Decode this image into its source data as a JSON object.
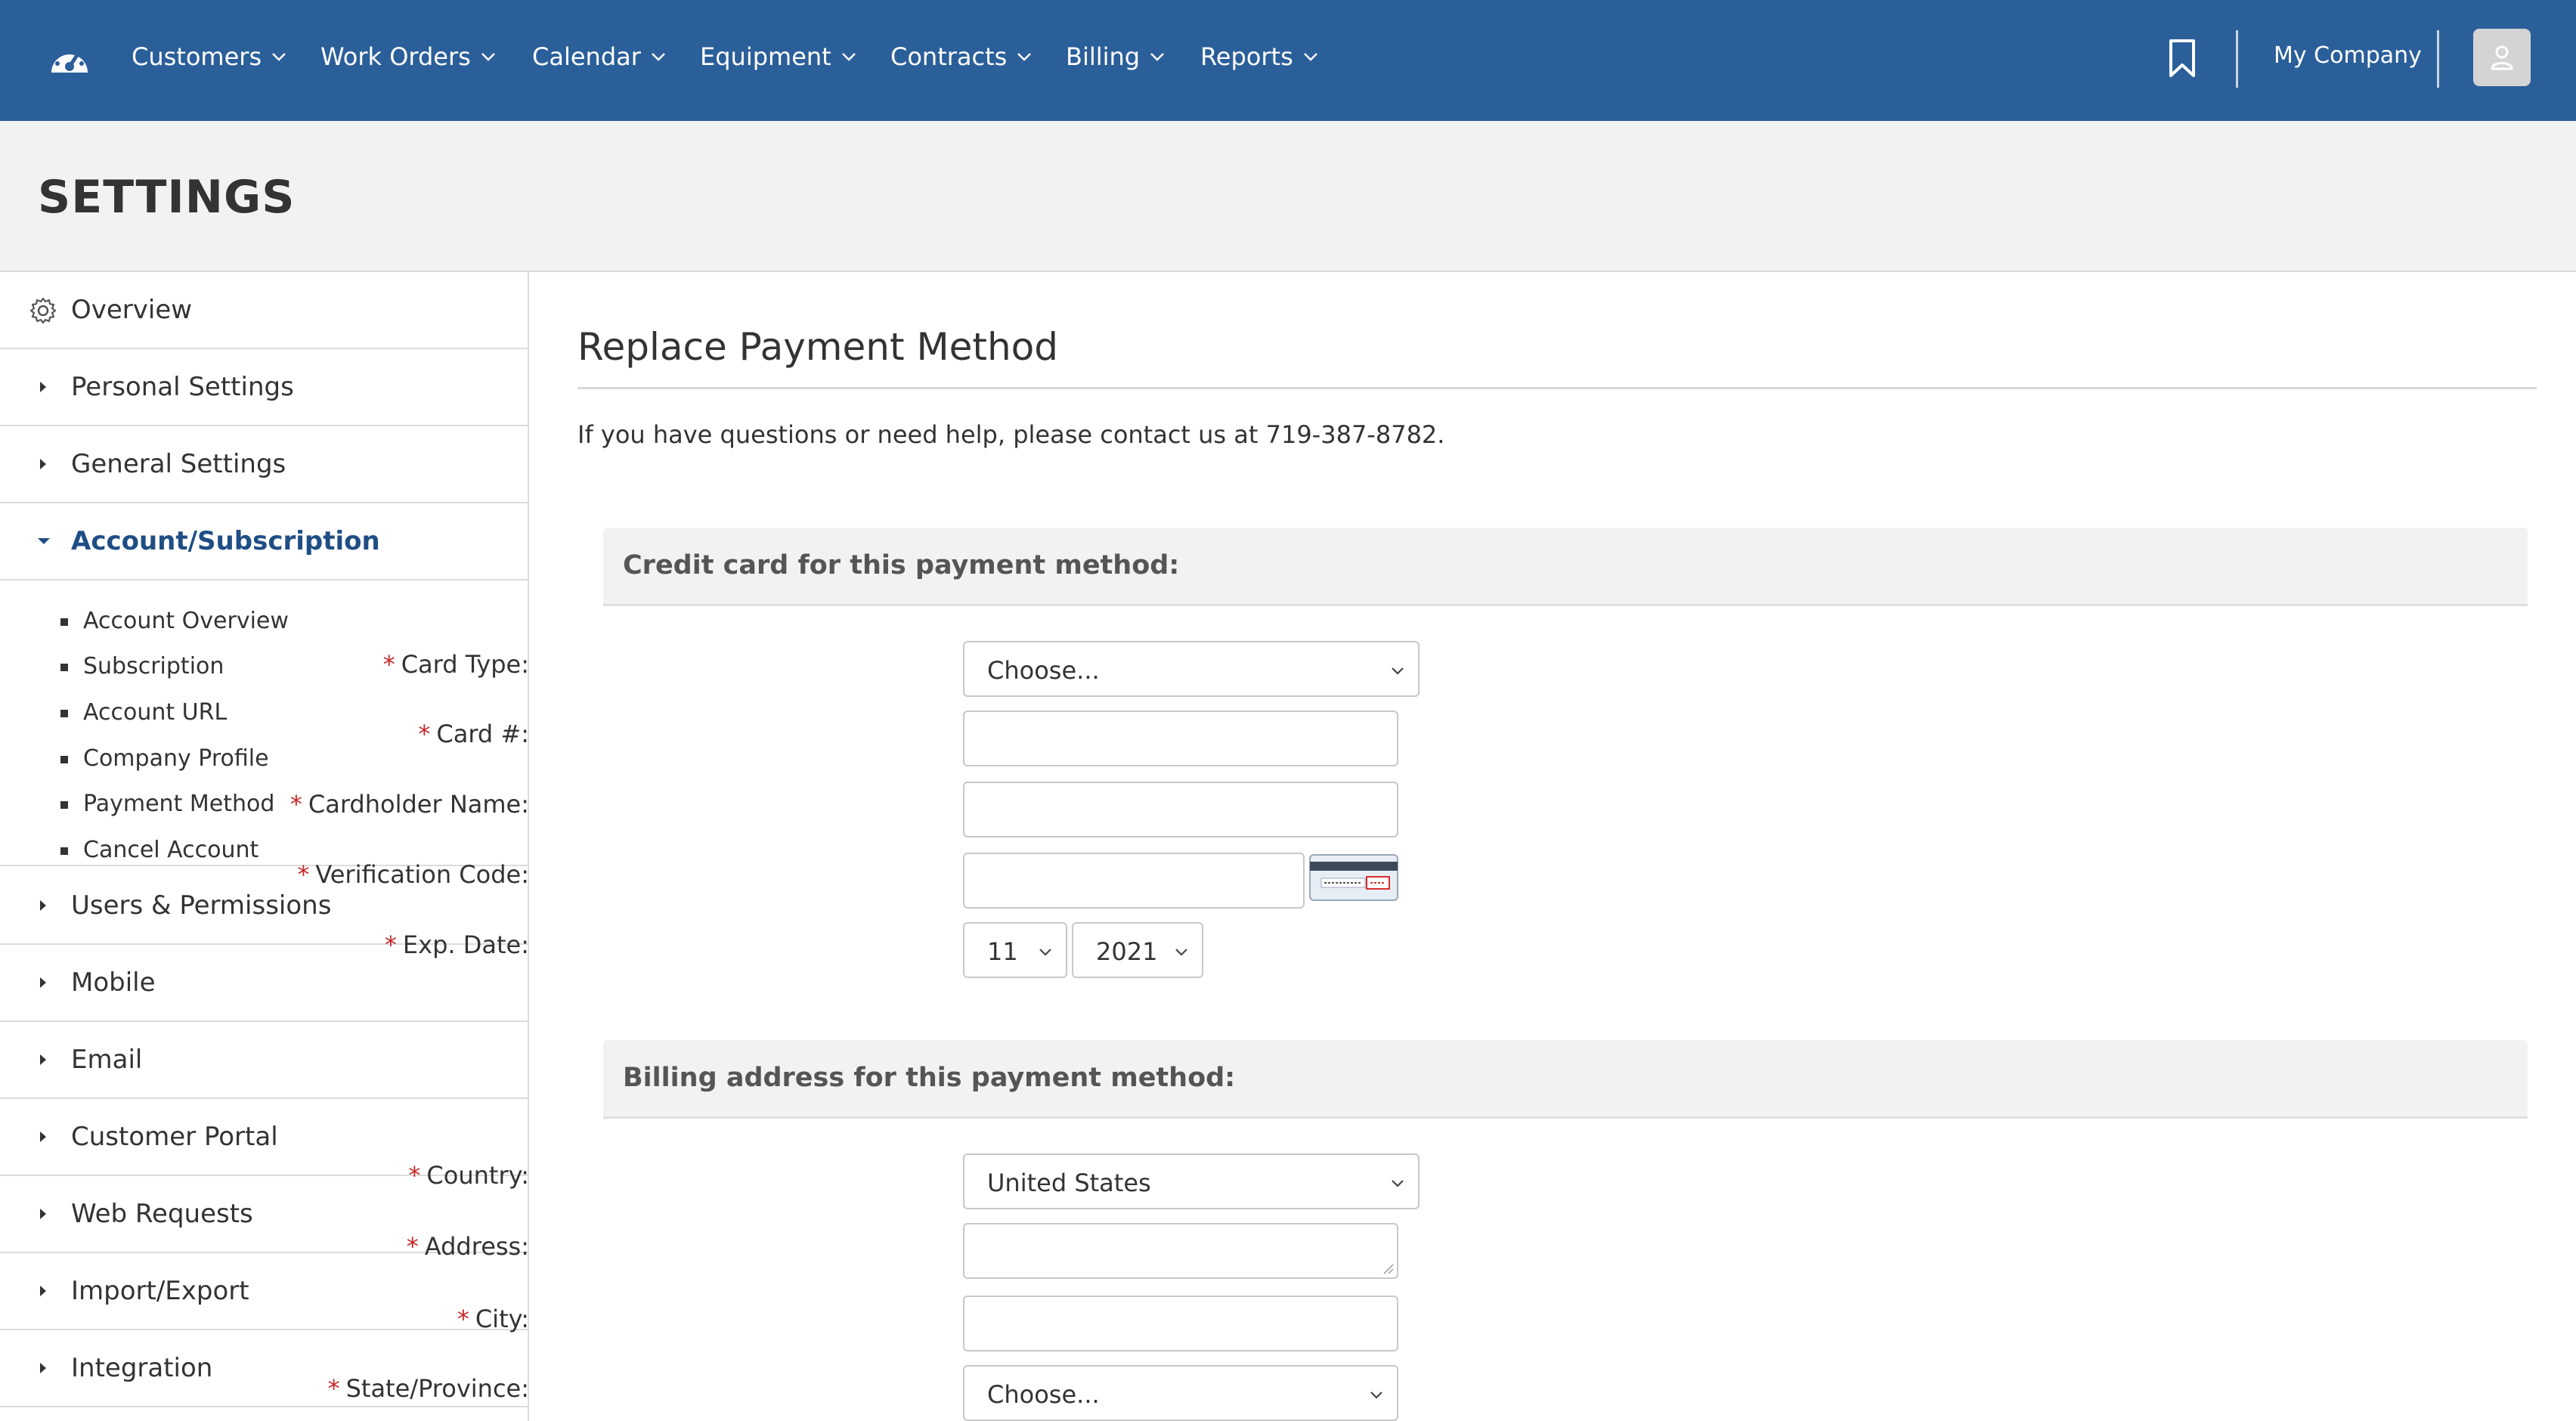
{
  "topnav": {
    "items": [
      {
        "label": "Customers"
      },
      {
        "label": "Work Orders"
      },
      {
        "label": "Calendar"
      },
      {
        "label": "Equipment"
      },
      {
        "label": "Contracts"
      },
      {
        "label": "Billing"
      },
      {
        "label": "Reports"
      }
    ],
    "company": "My Company",
    "icons": {
      "logo": "speedometer-icon",
      "bookmark": "bookmark-icon",
      "avatar": "user-icon"
    },
    "colors": {
      "background": "#2b5f9a",
      "text": "#ffffff"
    }
  },
  "header": {
    "title": "SETTINGS"
  },
  "sidebar": {
    "items": [
      {
        "label": "Overview",
        "icon": "gear-icon"
      },
      {
        "label": "Personal Settings",
        "icon": "caret-right-icon"
      },
      {
        "label": "General Settings",
        "icon": "caret-right-icon"
      },
      {
        "label": "Account/Subscription",
        "icon": "caret-down-icon",
        "active": true
      },
      {
        "label": "Users & Permissions",
        "icon": "caret-right-icon"
      },
      {
        "label": "Mobile",
        "icon": "caret-right-icon"
      },
      {
        "label": "Email",
        "icon": "caret-right-icon"
      },
      {
        "label": "Customer Portal",
        "icon": "caret-right-icon"
      },
      {
        "label": "Web Requests",
        "icon": "caret-right-icon"
      },
      {
        "label": "Import/Export",
        "icon": "caret-right-icon"
      },
      {
        "label": "Integration",
        "icon": "caret-right-icon"
      }
    ],
    "sub_items": [
      {
        "label": "Account Overview"
      },
      {
        "label": "Subscription"
      },
      {
        "label": "Account URL"
      },
      {
        "label": "Company Profile"
      },
      {
        "label": "Payment Method"
      },
      {
        "label": "Cancel Account"
      }
    ],
    "active_color": "#1f4e85"
  },
  "main": {
    "title": "Replace Payment Method",
    "help_text": "If you have questions or need help, please contact us at 719-387-8782.",
    "credit_section": {
      "heading": "Credit card for this payment method:",
      "card_type": {
        "label": "Card Type:",
        "value": "Choose..."
      },
      "card_number": {
        "label": "Card #:",
        "value": ""
      },
      "cardholder": {
        "label": "Cardholder Name:",
        "value": ""
      },
      "verification": {
        "label": "Verification Code:",
        "value": "",
        "image_icon": "card-back-cvv-icon"
      },
      "exp_date": {
        "label": "Exp. Date:",
        "month": "11",
        "year": "2021"
      }
    },
    "billing_section": {
      "heading": "Billing address for this payment method:",
      "country": {
        "label": "Country:",
        "value": "United States"
      },
      "address": {
        "label": "Address:",
        "value": ""
      },
      "city": {
        "label": "City:",
        "value": ""
      },
      "state": {
        "label": "State/Province:",
        "value": "Choose..."
      }
    },
    "required_marker": "*",
    "required_color": "#c62828"
  }
}
